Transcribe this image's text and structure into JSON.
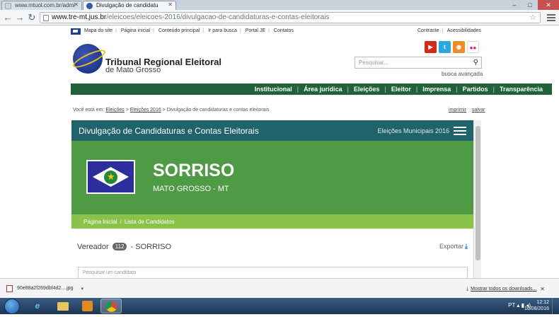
{
  "browser": {
    "tabs": [
      {
        "label": "www.mtuol.com.br/admi"
      },
      {
        "label": "Divulgação de candidatu"
      }
    ],
    "url_host": "www.tre-mt.jus.br",
    "url_path": "/eleicoes/eleicoes-2016/divulgacao-de-candidaturas-e-contas-eleitorais",
    "window_controls": {
      "minimize": "–",
      "maximize": "□",
      "close": "✕"
    }
  },
  "site": {
    "toplinks_left": [
      "Mapa do site",
      "Página inicial",
      "Conteúdo principal",
      "Ir para busca",
      "Portal JE",
      "Contatos"
    ],
    "toplinks_right": [
      "Contraste",
      "Acessibilidades"
    ],
    "logo_title": "Tribunal Regional Eleitoral",
    "logo_subtitle": "de Mato Grosso",
    "social": [
      "youtube-icon",
      "twitter-icon",
      "rss-icon",
      "flickr-icon"
    ],
    "search_placeholder": "Pesquisar...",
    "advanced_search": "busca avançada",
    "nav": [
      "Institucional",
      "Área jurídica",
      "Eleições",
      "Eleitor",
      "Imprensa",
      "Partidos",
      "Transparência"
    ],
    "breadcrumb_prefix": "Você está em:",
    "breadcrumb": [
      "Eleições",
      "Eleições 2016",
      "Divulgação de candidaturas e contas eleitorais"
    ],
    "print": "imprimir",
    "save": "salvar"
  },
  "panel": {
    "title": "Divulgação de Candidaturas e Contas Eleitorais",
    "election": "Eleições Municipais 2016",
    "city": "SORRISO",
    "state": "MATO GROSSO - MT",
    "subnav": [
      "Página Inicial",
      "Lista de Candidatos"
    ],
    "role": "Vereador",
    "count": "112",
    "role_suffix": "- SORRISO",
    "export": "Exportar",
    "search_candidate_placeholder": "Pesquisar um candidato"
  },
  "downloads": {
    "file": "90e88a2f269dbf4d2....jpg",
    "show_all": "Mostrar todos os downloads..."
  },
  "taskbar": {
    "time": "12:12",
    "date": "16/08/2016",
    "language": "PT"
  }
}
